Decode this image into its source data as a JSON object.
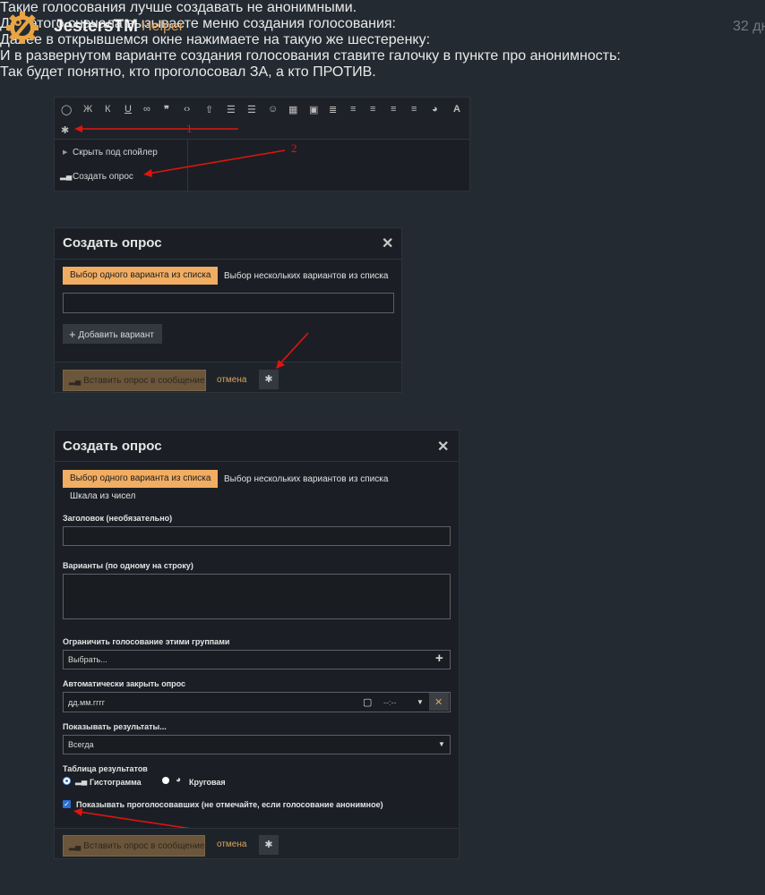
{
  "post": {
    "author": "JestersTM",
    "role": "Helper",
    "time": "32 дн",
    "para1": "Такие голосования лучше создавать не анонимными.",
    "para2": "Для этого сначала вызываете меню создания голосования:",
    "para3": "Далее в открывшемся окне нажимаете на такую же шестеренку:",
    "para4": "И в развернутом варианте создания голосования ставите галочку в пункте про анонимность:",
    "para5": "Так будет понятно, кто проголосовал ЗА, а кто ПРОТИВ."
  },
  "shot1": {
    "toolbar_italic": "Ж",
    "toolbar_k": "К",
    "toolbar_a": "A",
    "menu_spoiler": "Скрыть под спойлер",
    "menu_poll": "Создать опрос",
    "annotation_1": "1",
    "annotation_2": "2"
  },
  "shot2": {
    "title": "Создать опрос",
    "tab_single": "Выбор одного варианта из списка",
    "tab_multi": "Выбор нескольких вариантов из списка",
    "add_variant": "Добавить вариант",
    "insert": "Вставить опрос в сообщение",
    "cancel": "отмена"
  },
  "shot3": {
    "title": "Создать опрос",
    "tab_single": "Выбор одного варианта из списка",
    "tab_multi": "Выбор нескольких вариантов из списка",
    "tab_scale": "Шкала из чисел",
    "label_title": "Заголовок (необязательно)",
    "label_variants": "Варианты (по одному на строку)",
    "label_groups": "Ограничить голосование этими группами",
    "groups_value": "Выбрать...",
    "label_close": "Автоматически закрыть опрос",
    "date_placeholder": "дд.мм.гггг",
    "time_placeholder": "--:--",
    "label_show": "Показывать результаты...",
    "show_value": "Всегда",
    "label_table": "Таблица результатов",
    "radio_hist": "Гистограмма",
    "radio_pie": "Круговая",
    "checkbox_voters": "Показывать проголосовавших (не отмечайте, если голосование анонимное)",
    "insert": "Вставить опрос в сообщение",
    "cancel": "отмена"
  },
  "colors": {
    "page_bg": "#232a31",
    "accent_orange": "#f1ad62",
    "role_orange": "#d69c57",
    "arrow_red": "#e0140f"
  }
}
